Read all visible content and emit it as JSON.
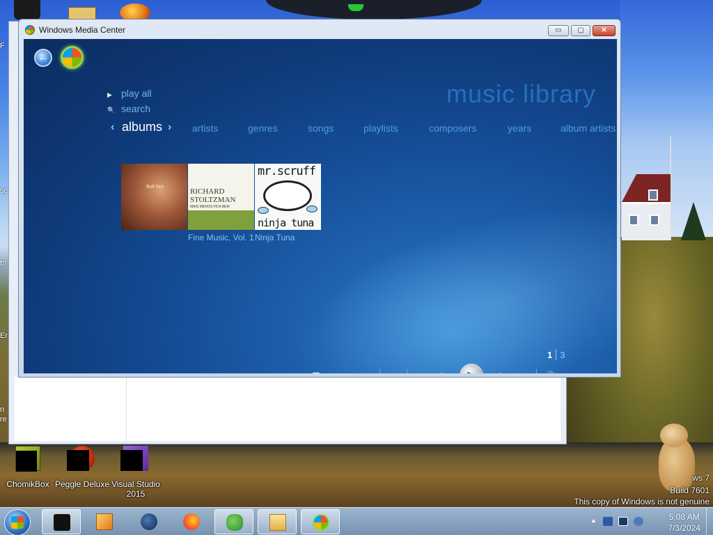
{
  "window": {
    "title": "Windows Media Center",
    "min_label": "▭",
    "max_label": "▢",
    "close_label": "✕"
  },
  "wmc": {
    "back_label": "←",
    "library_title": "music library",
    "commands": [
      {
        "label": "play all",
        "icon": "play-icon"
      },
      {
        "label": "search",
        "icon": "search-icon"
      }
    ],
    "pivots": [
      {
        "label": "albums",
        "active": true
      },
      {
        "label": "artists"
      },
      {
        "label": "genres"
      },
      {
        "label": "songs"
      },
      {
        "label": "playlists"
      },
      {
        "label": "composers"
      },
      {
        "label": "years"
      },
      {
        "label": "album artists"
      }
    ],
    "chevron_left": "‹",
    "chevron_right": "›",
    "albums": [
      {
        "title": "",
        "art_text": "Bolt Not"
      },
      {
        "title": "Fine Music, Vol. 1",
        "art_line1": "RICHARD",
        "art_line2": "STOLTZMAN",
        "art_line3": "MAIS MENOS FICA BEM"
      },
      {
        "title": "Ninja Tuna",
        "art_top": "mr.scruff",
        "art_bottom": "ninja tuna"
      }
    ],
    "pager": {
      "current": "1",
      "total": "3"
    },
    "transport": {
      "record": "●",
      "guide": "☰",
      "ch_down": "−",
      "ch_up": "+",
      "stop": "■",
      "rewind": "◀◀",
      "prev": "|◀",
      "play": "▶",
      "next": "▶|",
      "ff": "▶▶",
      "mute": "🔊",
      "vol_down": "−",
      "vol_up": "+"
    }
  },
  "desktop": {
    "icons": [
      {
        "label": "ChomikBox"
      },
      {
        "label": "Peggle Deluxe"
      },
      {
        "label": "Visual Studio 2015"
      }
    ],
    "left_fragments": [
      "F",
      "sc",
      "th",
      "Er",
      "n",
      "re"
    ],
    "watermark": {
      "line1": "ws 7",
      "line2": "Build 7601",
      "line3": "This copy of Windows is not genuine"
    }
  },
  "taskbar": {
    "clock_time": "5:08 AM",
    "clock_date": "7/3/2024",
    "tray_arrow": "▲",
    "items": [
      {
        "name": "taskbar-item-chomikbox"
      },
      {
        "name": "taskbar-item-media-player"
      },
      {
        "name": "taskbar-item-globe"
      },
      {
        "name": "taskbar-item-firefox"
      },
      {
        "name": "taskbar-item-messenger"
      },
      {
        "name": "taskbar-item-explorer"
      },
      {
        "name": "taskbar-item-media-center"
      }
    ]
  },
  "colors": {
    "accent": "#4b9de6",
    "stage_dark": "#0b2c60",
    "title_glow": "#2a78c6"
  }
}
